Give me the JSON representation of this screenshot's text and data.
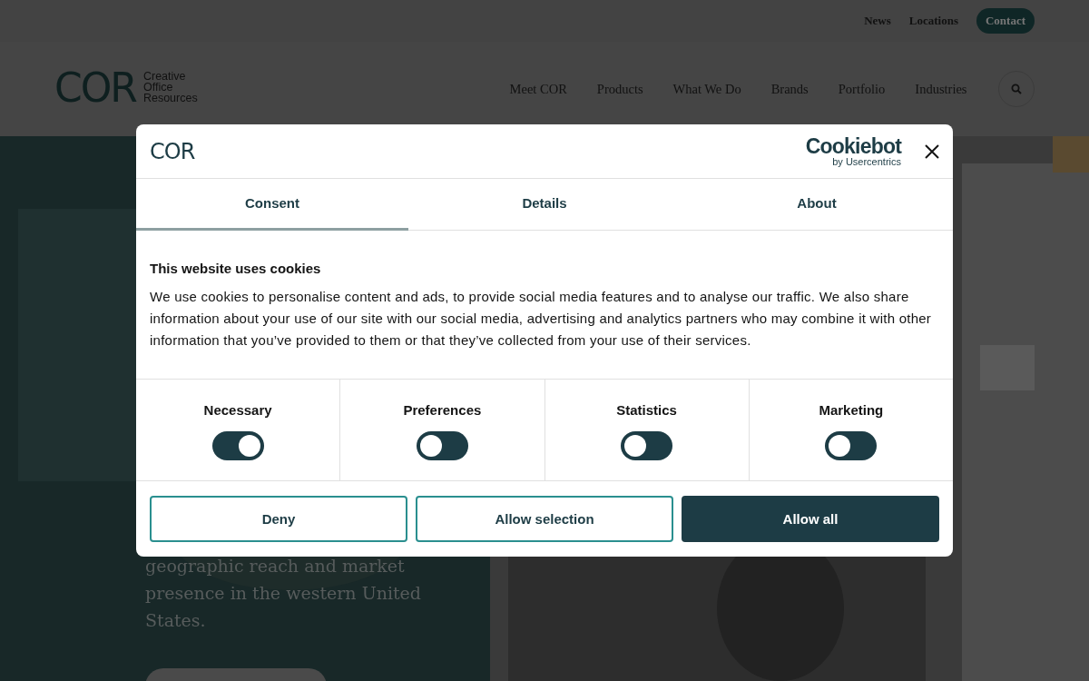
{
  "top_links": [
    {
      "label": "News",
      "kind": "link"
    },
    {
      "label": "Locations",
      "kind": "link"
    },
    {
      "label": "Contact",
      "kind": "button"
    }
  ],
  "logo": {
    "mark": "COR",
    "tagline": [
      "Creative",
      "Office",
      "Resources"
    ]
  },
  "nav": [
    "Meet COR",
    "Products",
    "What We Do",
    "Brands",
    "Portfolio",
    "Industries"
  ],
  "hero": {
    "kind": "picture",
    "text_lines": [
      "geographic reach and market",
      "presence in the western United",
      "States."
    ]
  },
  "dialog": {
    "logo": "COR",
    "brand": "Cookiebot",
    "brand_sub": "by Usercentrics",
    "tabs": [
      {
        "label": "Consent",
        "selected": true
      },
      {
        "label": "Details",
        "selected": false
      },
      {
        "label": "About",
        "selected": false
      }
    ],
    "heading": "This website uses cookies",
    "body": "We use cookies to personalise content and ads, to provide social media features and to analyse our traffic. We also share information about your use of our site with our social media, advertising and analytics partners who may combine it with other information that you’ve provided to them or that they’ve collected from your use of their services.",
    "categories": [
      {
        "label": "Necessary",
        "checked": true
      },
      {
        "label": "Preferences",
        "checked": false
      },
      {
        "label": "Statistics",
        "checked": false
      },
      {
        "label": "Marketing",
        "checked": false
      }
    ],
    "buttons": [
      {
        "label": "Deny",
        "kind": "outline"
      },
      {
        "label": "Allow selection",
        "kind": "outline"
      },
      {
        "label": "Allow all",
        "kind": "solid"
      }
    ]
  }
}
